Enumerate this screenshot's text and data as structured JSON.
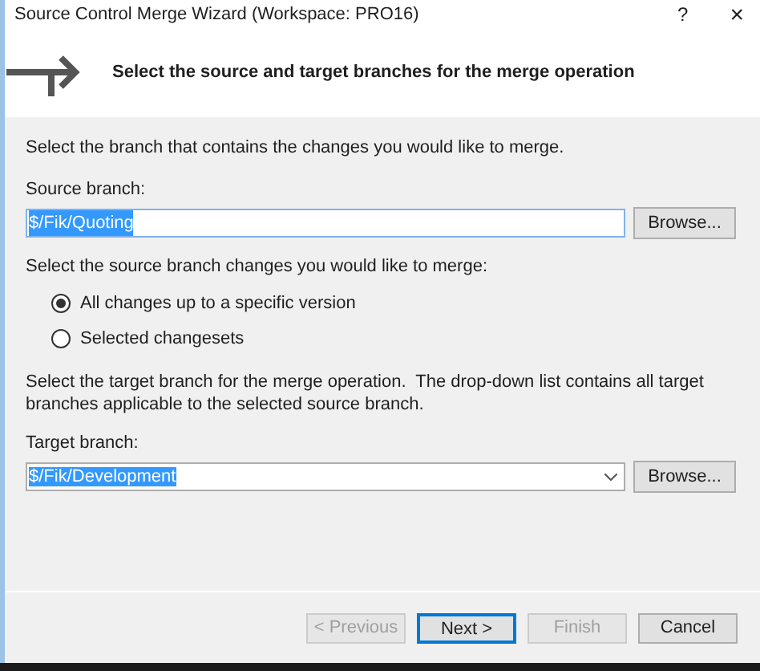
{
  "window": {
    "title": "Source Control Merge Wizard (Workspace: PRO16)",
    "help": "?",
    "close": "×"
  },
  "header": {
    "heading": "Select the source and target branches for the merge operation"
  },
  "source": {
    "instruction": "Select the branch that contains the changes you would like to merge.",
    "label": "Source branch:",
    "value": "$/Fik/Quoting",
    "browse": "Browse..."
  },
  "changes": {
    "instruction": "Select the source branch changes you would like to merge:",
    "options": [
      {
        "label": "All changes up to a specific version",
        "selected": true
      },
      {
        "label": "Selected changesets",
        "selected": false
      }
    ]
  },
  "target": {
    "instruction": "Select the target branch for the merge operation.  The drop-down list contains all target branches applicable to the selected source branch.",
    "label": "Target branch:",
    "value": "$/Fik/Development",
    "browse": "Browse..."
  },
  "buttons": [
    {
      "label": "< Previous",
      "disabled": true,
      "default": false
    },
    {
      "label": "Next >",
      "disabled": false,
      "default": true
    },
    {
      "label": "Finish",
      "disabled": true,
      "default": false
    },
    {
      "label": "Cancel",
      "disabled": false,
      "default": false
    }
  ]
}
